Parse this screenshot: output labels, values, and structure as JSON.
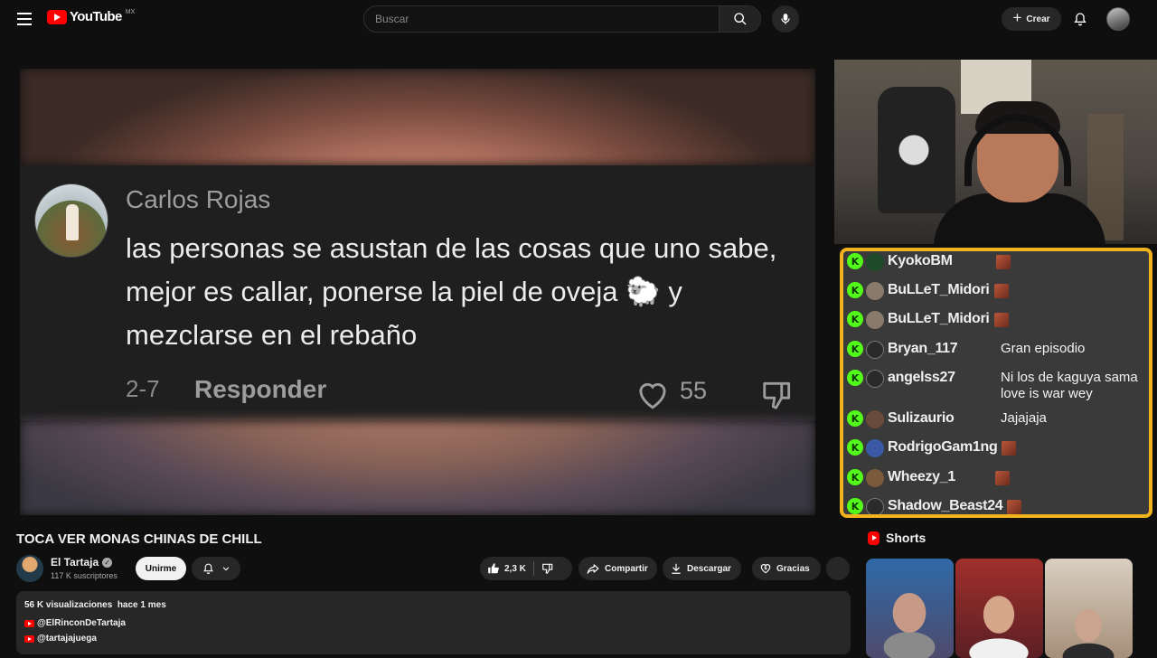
{
  "header": {
    "logo_text": "YouTube",
    "country_code": "MX",
    "search_placeholder": "Buscar",
    "create_label": "Crear"
  },
  "player": {
    "comment": {
      "author": "Carlos Rojas",
      "text": "las personas se asustan de las cosas que uno sabe, mejor es callar, ponerse la piel de oveja 🐑 y mezclarse en el rebaño",
      "date": "2-7",
      "reply_label": "Responder",
      "likes": "55"
    }
  },
  "chat": {
    "messages": [
      {
        "user": "KyokoBM",
        "message": "",
        "emote": true
      },
      {
        "user": "BuLLeT_Midori",
        "message": "",
        "emote": true
      },
      {
        "user": "BuLLeT_Midori",
        "message": "",
        "emote": true
      },
      {
        "user": "Bryan_117",
        "message": "Gran episodio",
        "emote": false
      },
      {
        "user": "angelss27",
        "message": "Ni los de kaguya sama love is war wey",
        "emote": false
      },
      {
        "user": "Sulizaurio",
        "message": "Jajajaja",
        "emote": false
      },
      {
        "user": "RodrigoGam1ng",
        "message": "",
        "emote": true
      },
      {
        "user": "Wheezy_1",
        "message": "",
        "emote": true
      },
      {
        "user": "Shadow_Beast24",
        "message": "",
        "emote": true
      }
    ]
  },
  "video": {
    "title": "TOCA VER MONAS CHINAS DE CHILL",
    "channel_name": "El Tartaja",
    "subscribers": "117 K suscriptores",
    "join_label": "Unirme",
    "likes": "2,3 K",
    "share_label": "Compartir",
    "download_label": "Descargar",
    "thanks_label": "Gracias"
  },
  "description": {
    "meta": "56 K visualizaciones  hace 1 mes",
    "links": [
      "@ElRinconDeTartaja",
      "@tartajajuega"
    ]
  },
  "shorts": {
    "heading": "Shorts"
  },
  "colors": {
    "background": "#0f0f0f",
    "brand_red": "#ff0000",
    "chat_border": "#f1b31d",
    "kick_green": "#53fc18"
  }
}
